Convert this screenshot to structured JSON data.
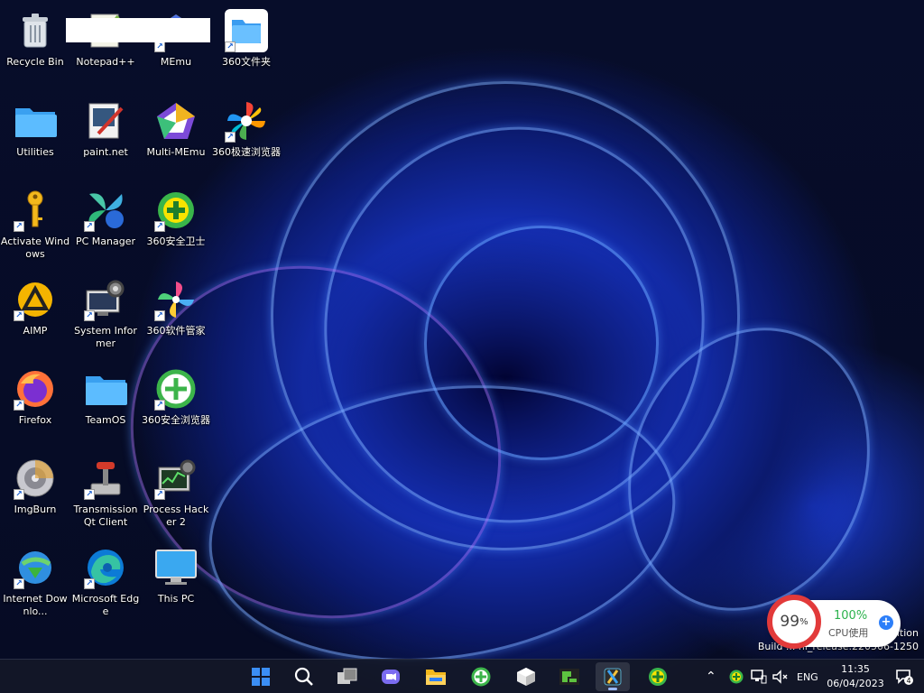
{
  "desktop": {
    "icons": [
      {
        "label": "Recycle Bin",
        "icon": "recycle-bin-icon"
      },
      {
        "label": "Notepad++",
        "icon": "notepadpp-icon"
      },
      {
        "label": "MEmu",
        "icon": "memu-icon"
      },
      {
        "label": "360文件夹",
        "icon": "folder-360-icon"
      },
      {
        "label": "Utilities",
        "icon": "folder-icon"
      },
      {
        "label": "paint.net",
        "icon": "paintnet-icon"
      },
      {
        "label": "Multi-MEmu",
        "icon": "multi-memu-icon"
      },
      {
        "label": "360极速浏览器",
        "icon": "browser-360-icon"
      },
      {
        "label": "Activate Windows",
        "icon": "key-icon"
      },
      {
        "label": "PC Manager",
        "icon": "pc-manager-icon"
      },
      {
        "label": "360安全卫士",
        "icon": "security-360-icon"
      },
      {
        "label": "AIMP",
        "icon": "aimp-icon"
      },
      {
        "label": "System Informer",
        "icon": "system-informer-icon"
      },
      {
        "label": "360软件管家",
        "icon": "software-360-icon"
      },
      {
        "label": "Firefox",
        "icon": "firefox-icon"
      },
      {
        "label": "TeamOS",
        "icon": "folder-icon"
      },
      {
        "label": "360安全浏览器",
        "icon": "safe-browser-360-icon"
      },
      {
        "label": "ImgBurn",
        "icon": "imgburn-icon"
      },
      {
        "label": "Transmission Qt Client",
        "icon": "transmission-icon"
      },
      {
        "label": "Process Hacker 2",
        "icon": "process-hacker-icon"
      },
      {
        "label": "Internet Downlo...",
        "icon": "idm-icon"
      },
      {
        "label": "Microsoft Edge",
        "icon": "edge-icon"
      },
      {
        "label": "This PC",
        "icon": "monitor-icon"
      }
    ]
  },
  "cpu_widget": {
    "usage_value": "99",
    "usage_unit": "%",
    "cpu_percent": "100%",
    "cpu_label": "CPU使用"
  },
  "watermark": {
    "line1": "ition",
    "line2": "Build ... ni_release.220506-1250"
  },
  "taskbar": {
    "apps": [
      "start-icon",
      "search-icon",
      "task-view-icon",
      "chat-icon",
      "file-explorer-icon",
      "browser-360-icon",
      "cube-app-icon",
      "green-app-icon",
      "snipping-icon",
      "security-360-icon"
    ],
    "tray": {
      "language": "ENG",
      "time": "11:35",
      "date": "06/04/2023",
      "notification_count": "4"
    }
  },
  "colors": {
    "accent": "#2d7ff9",
    "cpu_ring": "#e23a3a",
    "cpu_ok": "#2bb24c",
    "taskbar_bg": "#14182a"
  }
}
